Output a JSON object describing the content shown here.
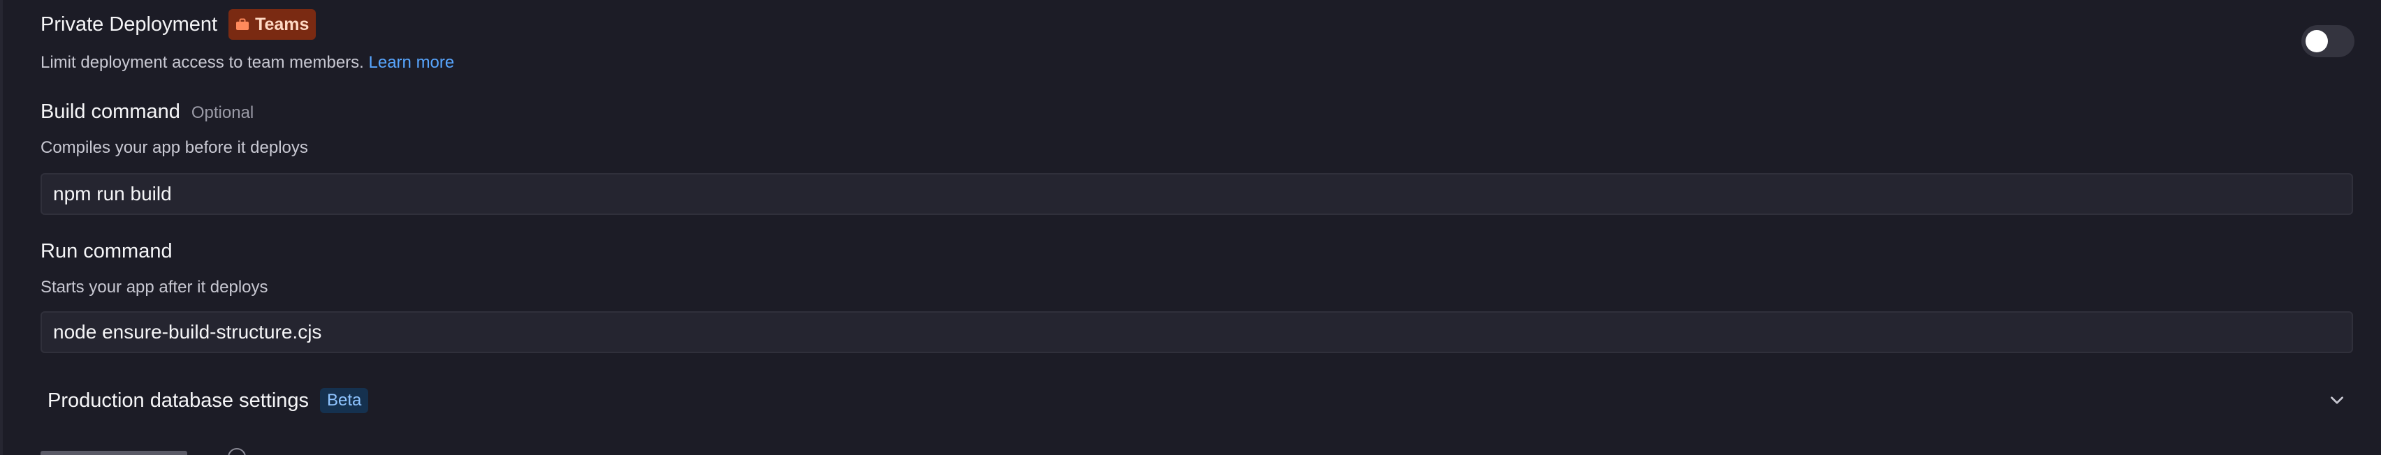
{
  "private_deployment": {
    "title": "Private Deployment",
    "badge_label": "Teams",
    "badge_icon": "briefcase-icon",
    "description": "Limit deployment access to team members.",
    "learn_more": "Learn more",
    "toggle_on": false
  },
  "build_command": {
    "title": "Build command",
    "optional_label": "Optional",
    "description": "Compiles your app before it deploys",
    "value": "npm run build"
  },
  "run_command": {
    "title": "Run command",
    "description": "Starts your app after it deploys",
    "value": "node ensure-build-structure.cjs"
  },
  "production_database": {
    "title": "Production database settings",
    "badge_label": "Beta",
    "expand_icon": "chevron-down-icon"
  },
  "colors": {
    "background": "#1c1c26",
    "input_background": "#252530",
    "teams_badge": "#7a2a12",
    "beta_badge": "#15314f",
    "link": "#58a6ff"
  }
}
